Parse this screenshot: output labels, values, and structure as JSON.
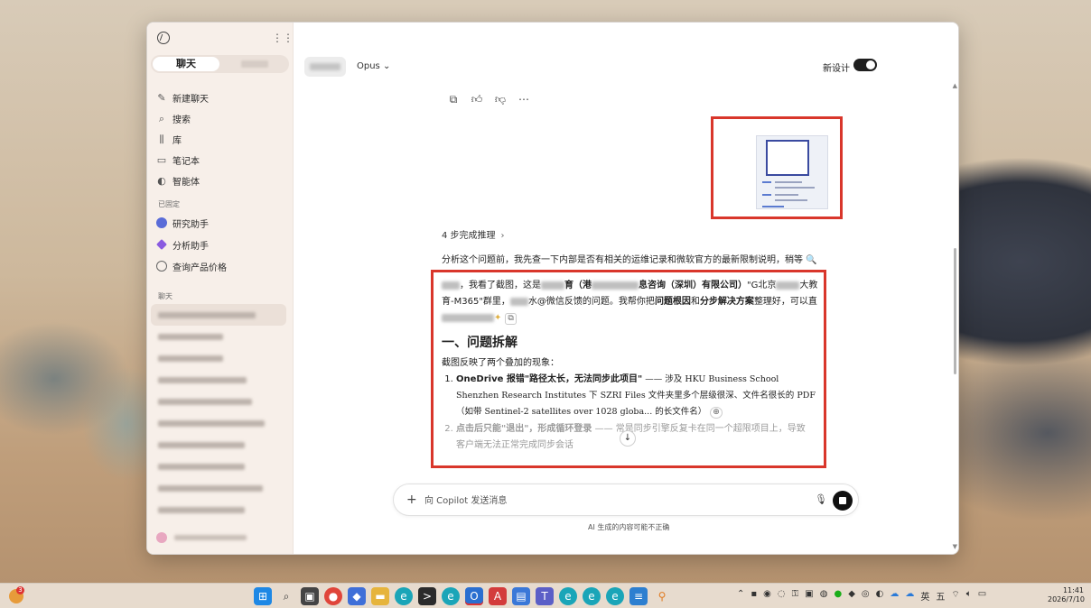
{
  "sidebar": {
    "tabs": {
      "active": "聊天"
    },
    "nav": [
      {
        "icon": "edit-icon",
        "label": "新建聊天"
      },
      {
        "icon": "search-icon",
        "label": "搜索"
      },
      {
        "icon": "library-icon",
        "label": "库"
      },
      {
        "icon": "notebook-icon",
        "label": "笔记本"
      },
      {
        "icon": "agent-icon",
        "label": "智能体"
      }
    ],
    "pinned_title": "已固定",
    "pinned": [
      {
        "label": "研究助手",
        "color": "#5a6cd8"
      },
      {
        "label": "分析助手",
        "color": "#8a5be0"
      },
      {
        "label": "查询产品价格",
        "color": "#777777"
      }
    ],
    "chats_title": "聊天"
  },
  "header": {
    "model": "Opus",
    "redesign_label": "新设计"
  },
  "message": {
    "reasoning": "4 步完成推理",
    "intro": "分析这个问题前，我先查一下内部是否有相关的运维记录和微软官方的最新限制说明，稍等 🔍",
    "reply": {
      "p1_a": "，我看了截图，这是",
      "p1_b": "育（港",
      "p1_c": "息咨询（深圳）有限公司）",
      "p1_d": "\"G北京",
      "p1_e": "大教育-M365\"群里，",
      "p1_f": "水@微信反馈的问题。我帮你把",
      "p1_g": "问题根因",
      "p1_h": "和",
      "p1_i": "分步解决方案",
      "p1_j": "整理好，可以直",
      "heading": "一、问题拆解",
      "lead": "截图反映了两个叠加的现象：",
      "item1_a": "OneDrive 报错\"路径太长，无法同步此项目\"",
      "item1_b": " —— 涉及 HKU Business School Shenzhen Research Institutes 下 SZRI Files 文件夹里多个层级很深、文件名很长的 PDF（如带 Sentinel-2 satellites over 1028 globa... 的长文件名）",
      "item2_a": "点击后只能\"退出\"，形成循环登录",
      "item2_b": " —— ",
      "item2_c": "常是同步引擎反复卡在同一个超限项目上，导致",
      "item2_d": "客户端无法正常完成同步会话"
    }
  },
  "composer": {
    "placeholder": "向 Copilot 发送消息",
    "disclaimer": "AI 生成的内容可能不正确"
  },
  "taskbar": {
    "weather_badge": "3",
    "tray_lang": "英",
    "tray_ime": "五",
    "time": "11:41",
    "date": "2026/7/10"
  }
}
